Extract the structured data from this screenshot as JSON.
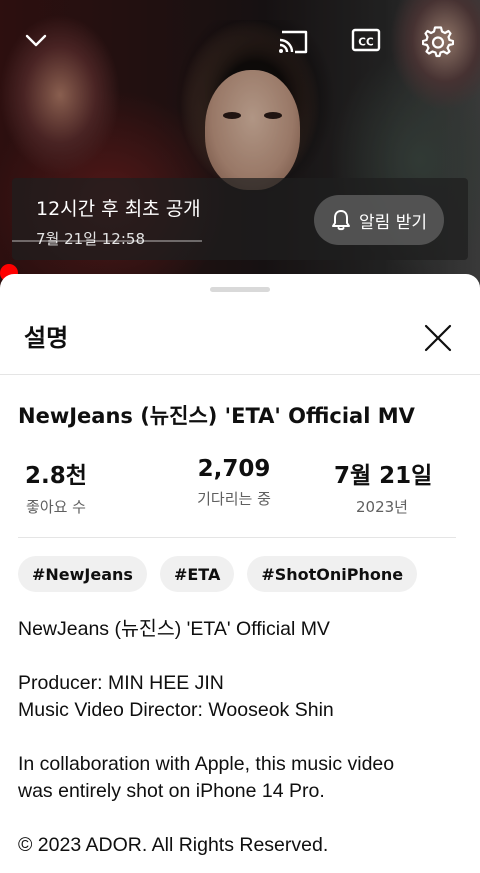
{
  "player": {
    "icons": {
      "collapse": "chevron-down-icon",
      "cast": "cast-icon",
      "captions": "closed-captions-icon",
      "settings": "gear-icon",
      "notify": "bell-icon",
      "close": "close-icon"
    },
    "premiere": {
      "title": "12시간 후 최초 공개",
      "date": "7월 21일 12:58",
      "notify_label": "알림 받기"
    },
    "progress_color": "#ff0000"
  },
  "sheet": {
    "title": "설명",
    "video_title": "NewJeans (뉴진스) 'ETA' Official MV",
    "stats": [
      {
        "value": "2.8천",
        "label": "좋아요 수"
      },
      {
        "value": "2,709",
        "label": "기다리는 중"
      },
      {
        "value": "7월 21일",
        "label": "2023년"
      }
    ],
    "hashtags": [
      "#NewJeans",
      "#ETA",
      "#ShotOniPhone"
    ],
    "description": [
      "NewJeans (뉴진스) 'ETA' Official MV",
      "Producer: MIN HEE JIN\nMusic Video Director: Wooseok Shin",
      "In collaboration with Apple, this music video\nwas entirely shot on iPhone 14 Pro.",
      "© 2023 ADOR. All Rights Reserved."
    ]
  }
}
